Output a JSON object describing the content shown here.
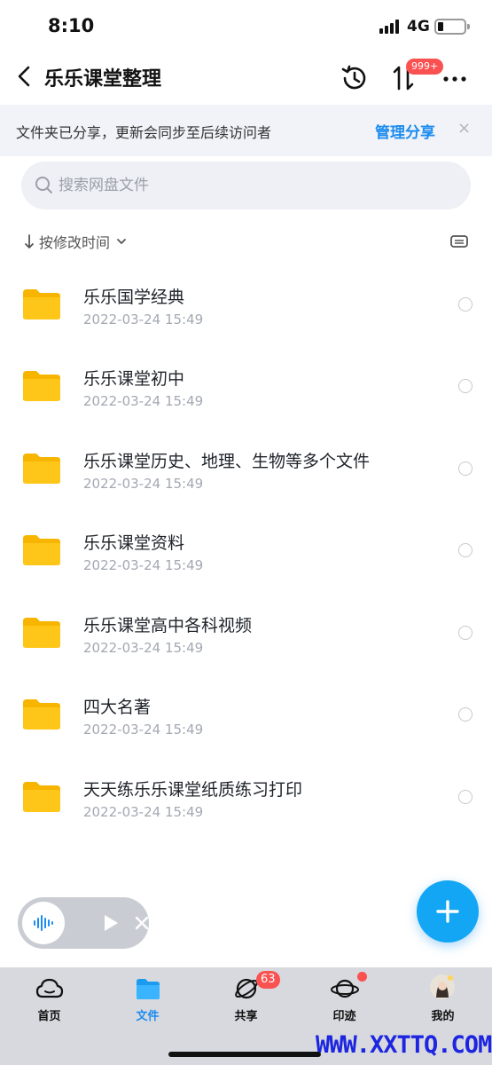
{
  "status": {
    "time": "8:10",
    "network": "4G"
  },
  "header": {
    "title": "乐乐课堂整理",
    "transfer_badge": "999+"
  },
  "share_banner": {
    "text": "文件夹已分享，更新会同步至后续访问者",
    "manage_label": "管理分享",
    "close_glyph": "×"
  },
  "search": {
    "placeholder": "搜索网盘文件"
  },
  "sort": {
    "label": "按修改时间"
  },
  "files": [
    {
      "name": "乐乐国学经典",
      "date": "2022-03-24 15:49"
    },
    {
      "name": "乐乐课堂初中",
      "date": "2022-03-24 15:49"
    },
    {
      "name": "乐乐课堂历史、地理、生物等多个文件",
      "date": "2022-03-24 15:49"
    },
    {
      "name": "乐乐课堂资料",
      "date": "2022-03-24 15:49"
    },
    {
      "name": "乐乐课堂高中各科视频",
      "date": "2022-03-24 15:49"
    },
    {
      "name": "四大名著",
      "date": "2022-03-24 15:49"
    },
    {
      "name": "天天练乐乐课堂纸质练习打印",
      "date": "2022-03-24 15:49"
    }
  ],
  "tabs": [
    {
      "label": "首页",
      "icon": "cloud-icon"
    },
    {
      "label": "文件",
      "icon": "folder-icon",
      "active": true
    },
    {
      "label": "共享",
      "icon": "orbit-icon",
      "badge": "63"
    },
    {
      "label": "印迹",
      "icon": "planet-icon",
      "dot": true
    },
    {
      "label": "我的",
      "icon": "avatar"
    }
  ],
  "watermark": "WWW.XXTTQ.COM",
  "colors": {
    "accent": "#1c8cf0",
    "fab": "#12a6f4",
    "folder": "#ffc61a",
    "badge": "#fa5151"
  }
}
